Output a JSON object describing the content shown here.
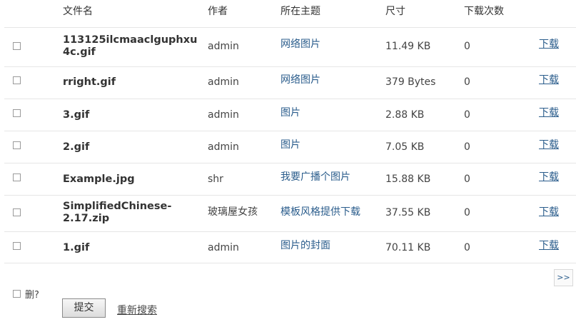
{
  "headers": {
    "filename": "文件名",
    "author": "作者",
    "topic": "所在主题",
    "size": "尺寸",
    "downloads": "下载次数"
  },
  "rows": [
    {
      "filename": "113125ilcmaaclguphxu4c.gif",
      "author": "admin",
      "topic": "网络图片",
      "size": "11.49 KB",
      "downloads": "0",
      "action": "下载"
    },
    {
      "filename": "rright.gif",
      "author": "admin",
      "topic": "网络图片",
      "size": "379 Bytes",
      "downloads": "0",
      "action": "下载"
    },
    {
      "filename": "3.gif",
      "author": "admin",
      "topic": "图片",
      "size": "2.88 KB",
      "downloads": "0",
      "action": "下载"
    },
    {
      "filename": "2.gif",
      "author": "admin",
      "topic": "图片",
      "size": "7.05 KB",
      "downloads": "0",
      "action": "下载"
    },
    {
      "filename": "Example.jpg",
      "author": "shr",
      "topic": "我要广播个图片",
      "size": "15.88 KB",
      "downloads": "0",
      "action": "下载"
    },
    {
      "filename": "SimplifiedChinese-2.17.zip",
      "author": "玻璃屋女孩",
      "topic": "模板风格提供下载",
      "size": "37.55 KB",
      "downloads": "0",
      "action": "下载"
    },
    {
      "filename": "1.gif",
      "author": "admin",
      "topic": "图片的封面",
      "size": "70.11 KB",
      "downloads": "0",
      "action": "下载"
    }
  ],
  "pagination": {
    "next_label": ">>"
  },
  "footer": {
    "delete_label": "删?",
    "submit_label": "提交",
    "research_label": "重新搜索"
  }
}
